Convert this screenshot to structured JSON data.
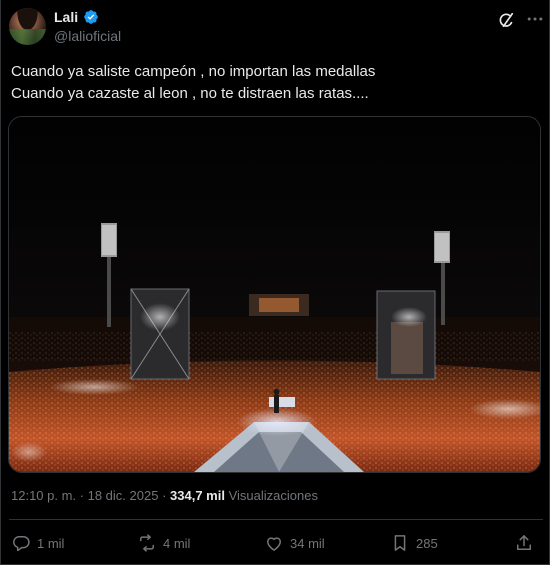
{
  "author": {
    "display_name": "Lali",
    "handle": "@lalioficial",
    "verified": true
  },
  "icons": {
    "verified": "verified-badge-icon",
    "grok": "grok-icon",
    "reply": "reply-icon",
    "repost": "repost-icon",
    "like": "like-icon",
    "bookmark": "bookmark-icon",
    "share": "share-icon"
  },
  "tweet": {
    "lines": [
      "Cuando ya saliste campeón , no importan las medallas",
      "Cuando ya cazaste al leon , no te distraen las ratas...."
    ]
  },
  "meta": {
    "time": "12:10 p. m.",
    "separator": " · ",
    "date": "18 dic. 2025",
    "views_count": "334,7 mil",
    "views_label": "Visualizaciones"
  },
  "actions": {
    "replies": "1 mil",
    "reposts": "4 mil",
    "likes": "34 mil",
    "bookmarks": "285"
  },
  "colors": {
    "background": "#000000",
    "text": "#e7e9ea",
    "secondary": "#71767b",
    "border": "#2f3336",
    "verified": "#1d9bf0"
  }
}
